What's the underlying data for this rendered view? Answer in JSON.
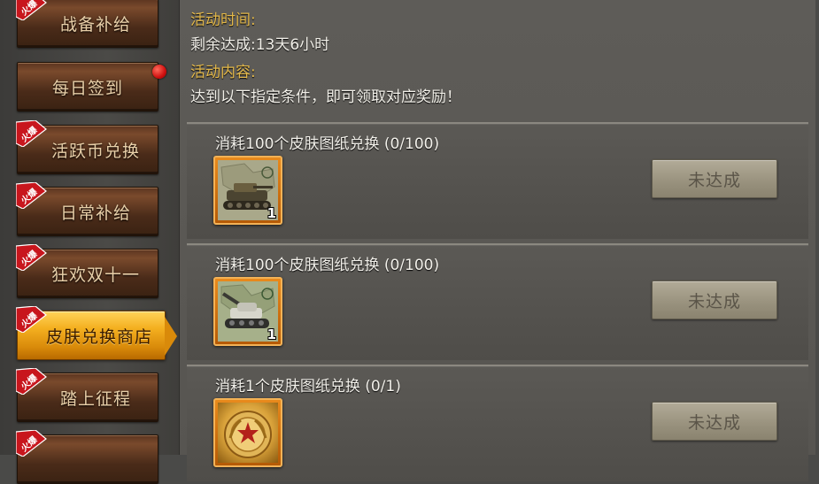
{
  "sidebar": {
    "items": [
      {
        "label": "战备补给",
        "hot_badge": "火爆",
        "active": false,
        "red_dot": false
      },
      {
        "label": "每日签到",
        "hot_badge": "",
        "active": false,
        "red_dot": true
      },
      {
        "label": "活跃币兑换",
        "hot_badge": "火爆",
        "active": false,
        "red_dot": false
      },
      {
        "label": "日常补给",
        "hot_badge": "火爆",
        "active": false,
        "red_dot": false
      },
      {
        "label": "狂欢双十一",
        "hot_badge": "火爆",
        "active": false,
        "red_dot": false
      },
      {
        "label": "皮肤兑换商店",
        "hot_badge": "火爆",
        "active": true,
        "red_dot": false
      },
      {
        "label": "踏上征程",
        "hot_badge": "火爆",
        "active": false,
        "red_dot": false
      },
      {
        "label": "",
        "hot_badge": "火爆",
        "active": false,
        "red_dot": false
      }
    ]
  },
  "activity": {
    "time_heading": "活动时间:",
    "time_text": "剩余达成:13天6小时",
    "content_heading": "活动内容:",
    "content_text": "达到以下指定条件，即可领取对应奖励！"
  },
  "tasks": [
    {
      "title": "消耗100个皮肤图纸兑换  (0/100)",
      "reward_icon": "tank-skin-icon",
      "reward_count": "1",
      "button_label": "未达成"
    },
    {
      "title": "消耗100个皮肤图纸兑换  (0/100)",
      "reward_icon": "artillery-skin-icon",
      "reward_count": "1",
      "button_label": "未达成"
    },
    {
      "title": "消耗1个皮肤图纸兑换  (0/1)",
      "reward_icon": "medal-emblem-icon",
      "reward_count": "",
      "button_label": "未达成"
    }
  ],
  "colors": {
    "accent_gold": "#e3b84a",
    "active_tab": "#f4b020",
    "red_dot": "#d01010",
    "hot_badge_red": "#c8161d"
  }
}
